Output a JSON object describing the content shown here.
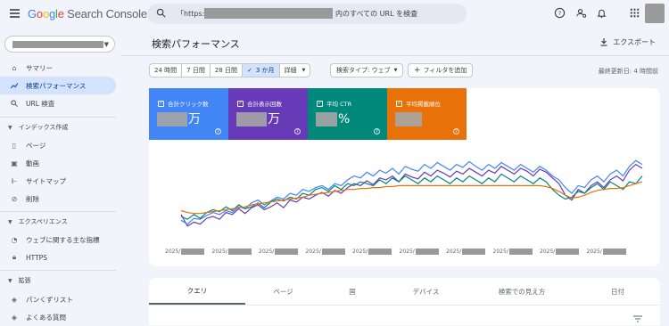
{
  "app": {
    "logo_google": "Google",
    "logo_product": " Search Console"
  },
  "search": {
    "prefix": "「https://",
    "suffix": "内のすべての URL を検査"
  },
  "sidebar": {
    "items": [
      {
        "label": "サマリー",
        "icon": "home-icon"
      },
      {
        "label": "検索パフォーマンス",
        "icon": "trend-icon",
        "active": true
      },
      {
        "label": "URL 検査",
        "icon": "search-icon"
      }
    ],
    "section_index": "インデックス作成",
    "index_items": [
      {
        "label": "ページ",
        "icon": "pages-icon"
      },
      {
        "label": "動画",
        "icon": "video-icon"
      },
      {
        "label": "サイトマップ",
        "icon": "sitemap-icon"
      },
      {
        "label": "削除",
        "icon": "removal-icon"
      }
    ],
    "section_experience": "エクスペリエンス",
    "experience_items": [
      {
        "label": "ウェブに関する主な指標",
        "icon": "speed-icon"
      },
      {
        "label": "HTTPS",
        "icon": "lock-icon"
      }
    ],
    "section_enhance": "拡張",
    "enhance_items": [
      {
        "label": "パンくずリスト",
        "icon": "layers-icon"
      },
      {
        "label": "よくある質問",
        "icon": "layers-icon"
      }
    ]
  },
  "header": {
    "title": "検索パフォーマンス",
    "export": "エクスポート"
  },
  "filters": {
    "ranges": [
      "24 時間",
      "7 日間",
      "28 日間",
      "3 か月"
    ],
    "selected_range": "3 か月",
    "detail": "詳細",
    "search_type": "検索タイプ: ウェブ",
    "add_filter": "フィルタを追加",
    "updated": "最終更新日: 4 時間前"
  },
  "cards": [
    {
      "label": "合計クリック数",
      "unit": "万",
      "color": "#4285f4"
    },
    {
      "label": "合計表示回数",
      "unit": "万",
      "color": "#673ab7"
    },
    {
      "label": "平均 CTR",
      "unit": "%",
      "color": "#00897b"
    },
    {
      "label": "平均掲載順位",
      "unit": "",
      "color": "#e8710a"
    }
  ],
  "chart_data": {
    "type": "line",
    "x_tick_prefix": "2025/",
    "x_tick_count": 10,
    "series": [
      {
        "values": [
          40,
          28,
          32,
          30,
          36,
          38,
          35,
          42,
          40,
          46,
          41,
          47,
          50,
          45,
          48,
          52,
          47,
          55,
          53,
          58,
          56,
          60,
          63,
          59,
          65,
          62,
          68,
          72,
          70,
          75,
          71,
          78,
          76,
          80,
          74,
          82,
          79,
          77,
          84,
          80,
          86,
          83,
          79,
          85,
          82,
          88,
          84,
          80,
          86,
          83,
          90,
          86,
          82,
          88,
          85,
          80,
          87,
          84,
          78,
          72,
          60,
          55,
          66,
          62,
          70,
          74,
          68,
          76,
          80,
          75,
          86,
          92,
          88
        ]
      },
      {
        "values": [
          34,
          30,
          36,
          35,
          39,
          42,
          40,
          44,
          42,
          48,
          46,
          52,
          55,
          50,
          54,
          58,
          56,
          62,
          60,
          66,
          64,
          68,
          70,
          66,
          72,
          70,
          76,
          80,
          78,
          84,
          80,
          86,
          83,
          88,
          82,
          90,
          87,
          85,
          92,
          88,
          94,
          90,
          86,
          92,
          89,
          95,
          90,
          86,
          92,
          88,
          94,
          90,
          86,
          92,
          88,
          84,
          90,
          86,
          80,
          76,
          68,
          62,
          70,
          68,
          76,
          80,
          74,
          82,
          86,
          80,
          90,
          96,
          92
        ]
      },
      {
        "values": [
          38,
          35,
          40,
          36,
          42,
          45,
          43,
          48,
          44,
          50,
          46,
          48,
          52,
          47,
          53,
          56,
          54,
          58,
          56,
          62,
          60,
          66,
          68,
          64,
          70,
          66,
          72,
          70,
          74,
          72,
          70,
          76,
          72,
          78,
          74,
          80,
          76,
          72,
          78,
          74,
          80,
          76,
          72,
          78,
          74,
          80,
          76,
          72,
          78,
          74,
          82,
          78,
          74,
          80,
          76,
          72,
          78,
          74,
          66,
          60,
          56,
          58,
          64,
          62,
          68,
          72,
          66,
          74,
          70,
          66,
          74,
          72,
          80
        ]
      },
      {
        "values": [
          44,
          42,
          41,
          41,
          42,
          43,
          44,
          45,
          46,
          47,
          48,
          50,
          51,
          52,
          53,
          54,
          55,
          56,
          57,
          58,
          60,
          61,
          62,
          63,
          64,
          65,
          66,
          66,
          67,
          67,
          68,
          68,
          69,
          69,
          70,
          70,
          70,
          70,
          70,
          70,
          70,
          70,
          70,
          70,
          70,
          70,
          70,
          70,
          70,
          70,
          70,
          70,
          70,
          70,
          70,
          70,
          70,
          69,
          67,
          64,
          60,
          57,
          58,
          60,
          63,
          65,
          66,
          67,
          67,
          68,
          70,
          72,
          74
        ]
      }
    ]
  },
  "tabs": [
    "クエリ",
    "ページ",
    "国",
    "デバイス",
    "検索での見え方",
    "日付"
  ],
  "selected_tab": "クエリ"
}
